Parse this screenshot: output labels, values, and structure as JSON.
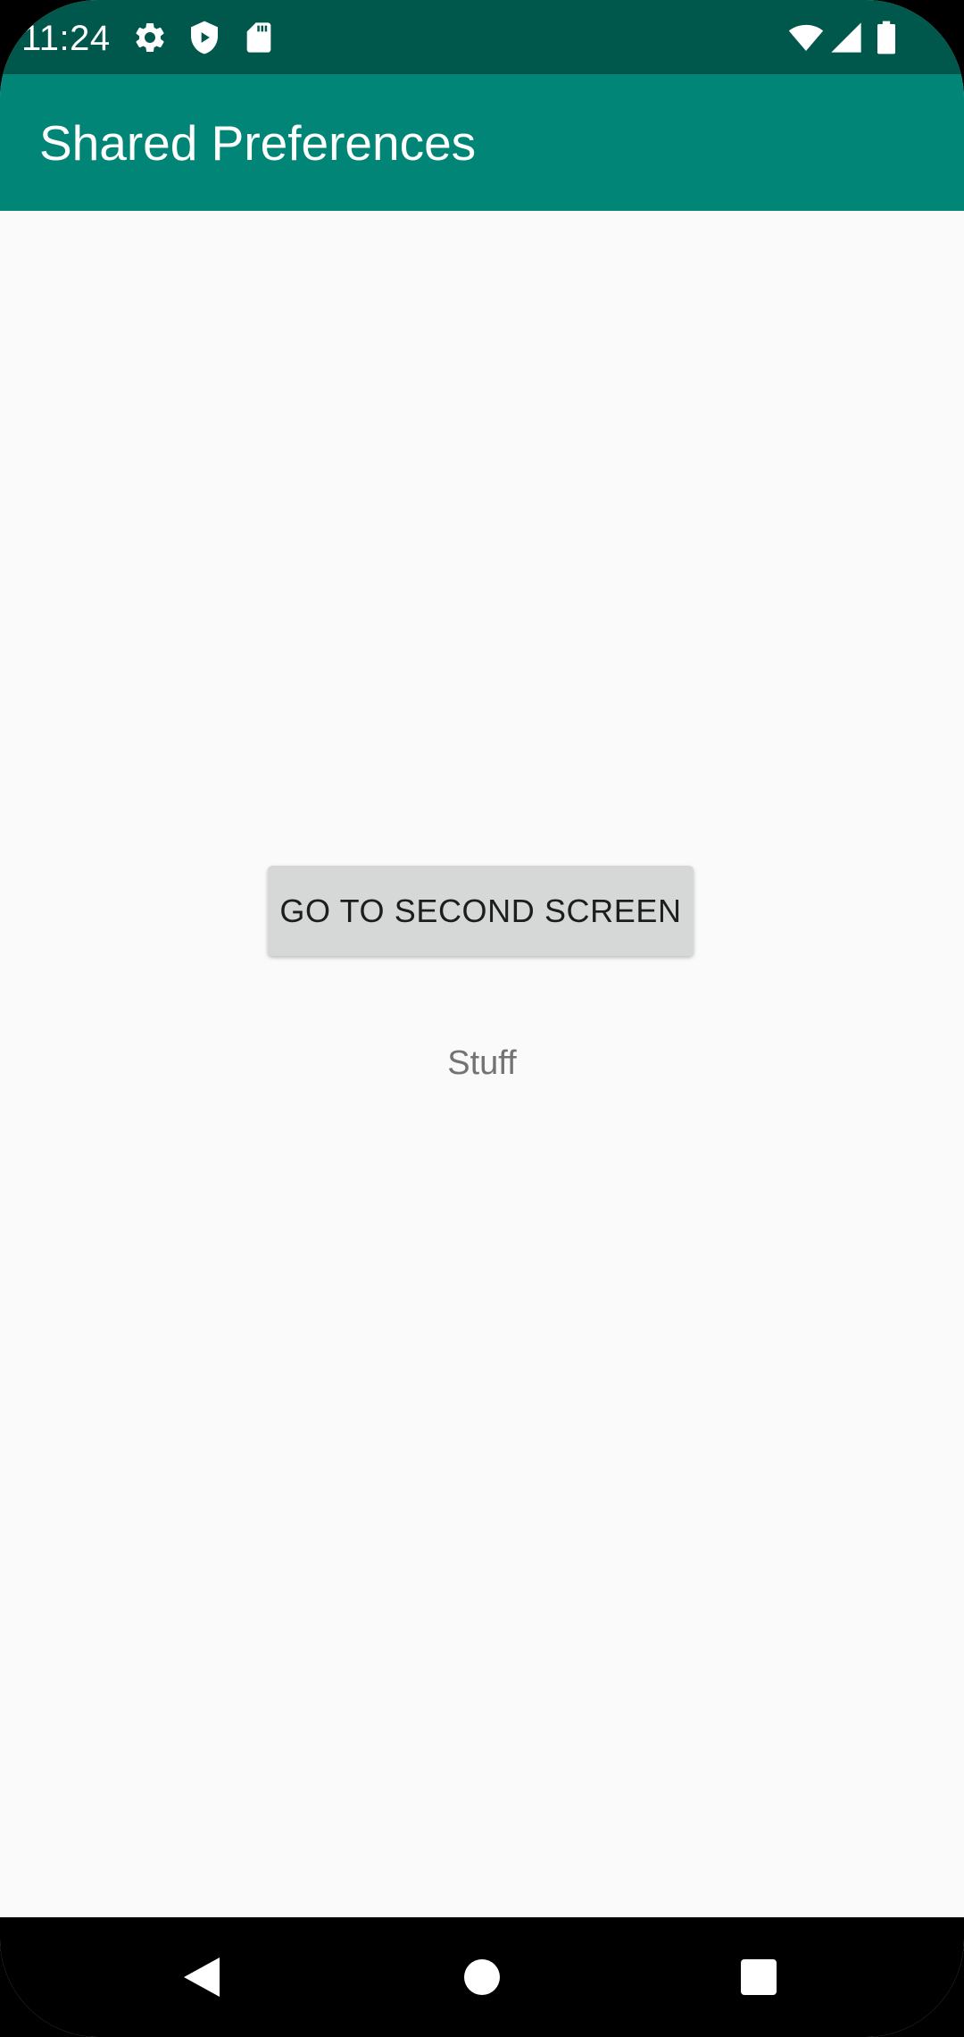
{
  "status_bar": {
    "time": "11:24",
    "background": "#00574b",
    "left_icons": [
      "settings-icon",
      "shield-icon",
      "sd-card-icon"
    ],
    "right_icons": [
      "wifi-icon",
      "cell-signal-icon",
      "battery-icon"
    ]
  },
  "app_bar": {
    "title": "Shared Preferences",
    "background": "#008577"
  },
  "main": {
    "button_label": "GO TO SECOND SCREEN",
    "text_label": "Stuff",
    "background": "#fafafa"
  },
  "nav_bar": {
    "buttons": [
      "back-icon",
      "home-icon",
      "recents-icon"
    ],
    "background": "#000000"
  }
}
